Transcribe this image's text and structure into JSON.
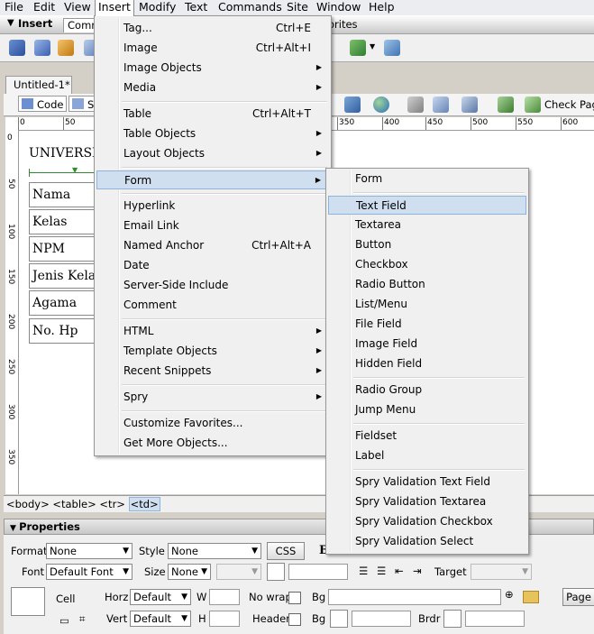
{
  "menubar": {
    "items": [
      {
        "label": "File"
      },
      {
        "label": "Edit"
      },
      {
        "label": "View"
      },
      {
        "label": "Insert"
      },
      {
        "label": "Modify"
      },
      {
        "label": "Text"
      },
      {
        "label": "Commands"
      },
      {
        "label": "Site"
      },
      {
        "label": "Window"
      },
      {
        "label": "Help"
      }
    ]
  },
  "insert_panel": {
    "title": "Insert",
    "tabs": [
      "Comm",
      "orites"
    ]
  },
  "document": {
    "tab": "Untitled-1*",
    "code_button": "Code",
    "split_button": "S",
    "check_page": "Check Page",
    "heading_text": "UNIVERSI",
    "form_rows": [
      "Nama",
      "Kelas",
      "NPM",
      "Jenis Kelam",
      "Agama",
      "No. Hp"
    ],
    "ruler_top": [
      "0",
      "50",
      "350",
      "400",
      "450",
      "500",
      "550",
      "600"
    ],
    "ruler_left": [
      "0",
      "50",
      "100",
      "150",
      "200",
      "250",
      "300",
      "350"
    ],
    "tag_selector": "<body> <table> <tr>",
    "tag_selected": "<td>"
  },
  "insert_menu": {
    "items": [
      {
        "label": "Tag...",
        "shortcut": "Ctrl+E",
        "submenu": false
      },
      {
        "label": "Image",
        "shortcut": "Ctrl+Alt+I",
        "submenu": false
      },
      {
        "label": "Image Objects",
        "shortcut": "",
        "submenu": true
      },
      {
        "label": "Media",
        "shortcut": "",
        "submenu": true
      },
      {
        "label": "Table",
        "shortcut": "Ctrl+Alt+T",
        "submenu": false
      },
      {
        "label": "Table Objects",
        "shortcut": "",
        "submenu": true
      },
      {
        "label": "Layout Objects",
        "shortcut": "",
        "submenu": true
      },
      {
        "label": "Form",
        "shortcut": "",
        "submenu": true
      },
      {
        "label": "Hyperlink",
        "shortcut": "",
        "submenu": false
      },
      {
        "label": "Email Link",
        "shortcut": "",
        "submenu": false
      },
      {
        "label": "Named Anchor",
        "shortcut": "Ctrl+Alt+A",
        "submenu": false
      },
      {
        "label": "Date",
        "shortcut": "",
        "submenu": false
      },
      {
        "label": "Server-Side Include",
        "shortcut": "",
        "submenu": false
      },
      {
        "label": "Comment",
        "shortcut": "",
        "submenu": false
      },
      {
        "label": "HTML",
        "shortcut": "",
        "submenu": true
      },
      {
        "label": "Template Objects",
        "shortcut": "",
        "submenu": true
      },
      {
        "label": "Recent Snippets",
        "shortcut": "",
        "submenu": true
      },
      {
        "label": "Spry",
        "shortcut": "",
        "submenu": true
      },
      {
        "label": "Customize Favorites...",
        "shortcut": "",
        "submenu": false
      },
      {
        "label": "Get More Objects...",
        "shortcut": "",
        "submenu": false
      }
    ]
  },
  "form_submenu": {
    "items": [
      "Form",
      "Text Field",
      "Textarea",
      "Button",
      "Checkbox",
      "Radio Button",
      "List/Menu",
      "File Field",
      "Image Field",
      "Hidden Field",
      "Radio Group",
      "Jump Menu",
      "Fieldset",
      "Label",
      "Spry Validation Text Field",
      "Spry Validation Textarea",
      "Spry Validation Checkbox",
      "Spry Validation Select"
    ]
  },
  "properties": {
    "title": "Properties",
    "format_label": "Format",
    "format_value": "None",
    "style_label": "Style",
    "style_value": "None",
    "css_button": "CSS",
    "bold_button": "B",
    "font_label": "Font",
    "font_value": "Default Font",
    "size_label": "Size",
    "size_value": "None",
    "target_label": "Target",
    "cell_label": "Cell",
    "horz_label": "Horz",
    "horz_value": "Default",
    "vert_label": "Vert",
    "vert_value": "Default",
    "w_label": "W",
    "h_label": "H",
    "nowrap_label": "No wrap",
    "header_label": "Header",
    "bg_label": "Bg",
    "bg2_label": "Bg",
    "brdr_label": "Brdr",
    "page_button": "Page"
  },
  "colors": {
    "highlight": "#cfdff0",
    "highlight_border": "#8fb4dc",
    "menu_bg": "#f0f0f0"
  }
}
